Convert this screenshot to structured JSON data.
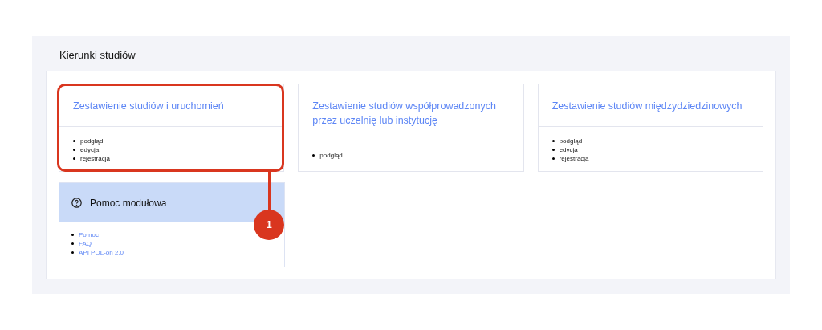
{
  "section": {
    "title": "Kierunki studiów"
  },
  "cards": [
    {
      "title": "Zestawienie studiów i uruchomień",
      "items": [
        "podgląd",
        "edycja",
        "rejestracja"
      ],
      "highlighted": true
    },
    {
      "title": "Zestawienie studiów współprowadzonych przez uczelnię lub instytucję",
      "items": [
        "podgląd"
      ],
      "highlighted": false
    },
    {
      "title": "Zestawienie studiów międzydziedzinowych",
      "items": [
        "podgląd",
        "edycja",
        "rejestracja"
      ],
      "highlighted": false
    }
  ],
  "help": {
    "title": "Pomoc modułowa",
    "links": [
      "Pomoc",
      "FAQ",
      "API POL-on 2.0"
    ]
  },
  "annotation": {
    "number": "1"
  }
}
